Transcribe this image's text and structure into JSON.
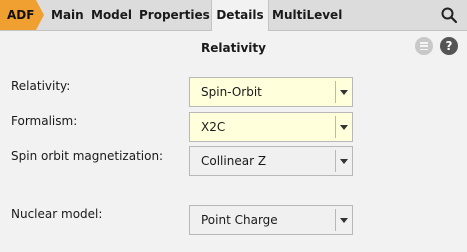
{
  "tabs": {
    "adf": "ADF",
    "items": [
      "Main",
      "Model",
      "Properties",
      "Details",
      "MultiLevel"
    ],
    "active": "Details"
  },
  "panel": {
    "title": "Relativity",
    "help_label": "?"
  },
  "fields": [
    {
      "label": "Relativity:",
      "value": "Spin-Orbit"
    },
    {
      "label": "Formalism:",
      "value": "X2C"
    },
    {
      "label": "Spin orbit magnetization:",
      "value": "Collinear Z"
    },
    {
      "label": "Nuclear model:",
      "value": "Point Charge"
    }
  ],
  "colors": {
    "adf_tab": "#f0a030",
    "highlight_field": "#ffffdc"
  },
  "icons": [
    "search-icon",
    "menu-icon",
    "help-icon",
    "dropdown-arrow-icon"
  ]
}
